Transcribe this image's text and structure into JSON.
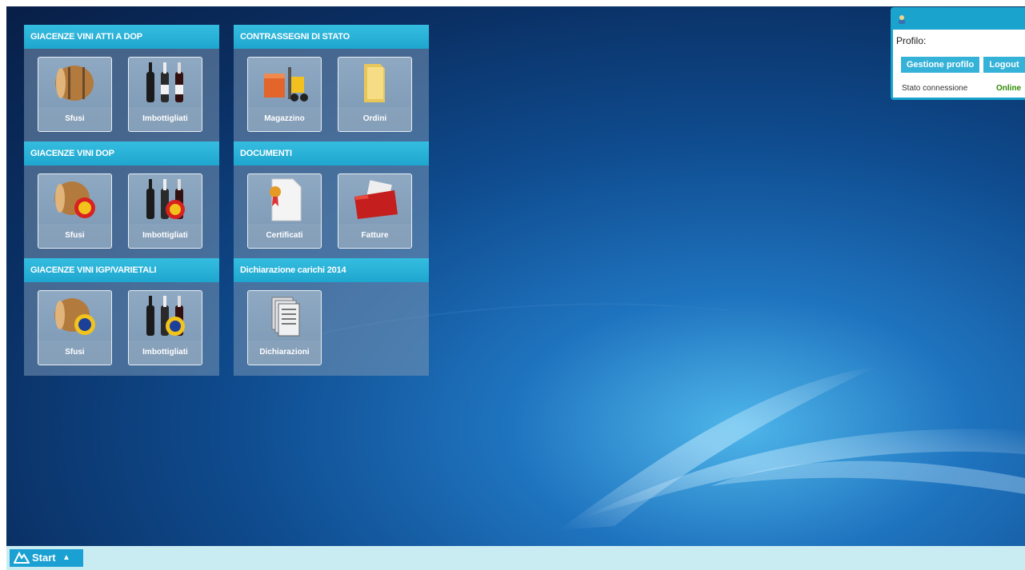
{
  "sections": [
    {
      "title": "GIACENZE VINI ATTI A DOP",
      "tiles": [
        {
          "label": "Sfusi",
          "icon": "barrel-icon"
        },
        {
          "label": "Imbottigliati",
          "icon": "bottles-icon"
        }
      ]
    },
    {
      "title": "GIACENZE VINI DOP",
      "tiles": [
        {
          "label": "Sfusi",
          "icon": "barrel-dop-seal-icon"
        },
        {
          "label": "Imbottigliati",
          "icon": "bottles-dop-seal-icon"
        }
      ]
    },
    {
      "title": "GIACENZE VINI IGP/VARIETALI",
      "tiles": [
        {
          "label": "Sfusi",
          "icon": "barrel-igp-seal-icon"
        },
        {
          "label": "Imbottigliati",
          "icon": "bottles-igp-seal-icon"
        }
      ]
    },
    {
      "title": "CONTRASSEGNI DI STATO",
      "tiles": [
        {
          "label": "Magazzino",
          "icon": "forklift-icon"
        },
        {
          "label": "Ordini",
          "icon": "folder-icon"
        }
      ]
    },
    {
      "title": "DOCUMENTI",
      "tiles": [
        {
          "label": "Certificati",
          "icon": "certificate-icon"
        },
        {
          "label": "Fatture",
          "icon": "invoice-folder-icon"
        }
      ]
    },
    {
      "title": "Dichiarazione carichi 2014",
      "tiles": [
        {
          "label": "Dichiarazioni",
          "icon": "documents-stack-icon"
        }
      ]
    }
  ],
  "profile": {
    "label": "Profilo:",
    "manage_button": "Gestione profilo",
    "logout_button": "Logout",
    "connection_label": "Stato connessione",
    "connection_status": "Online",
    "status_color": "#2e8b00"
  },
  "taskbar": {
    "start_label": "Start"
  },
  "colors": {
    "accent": "#1ea6cf",
    "taskbar": "#c9ecf2"
  }
}
